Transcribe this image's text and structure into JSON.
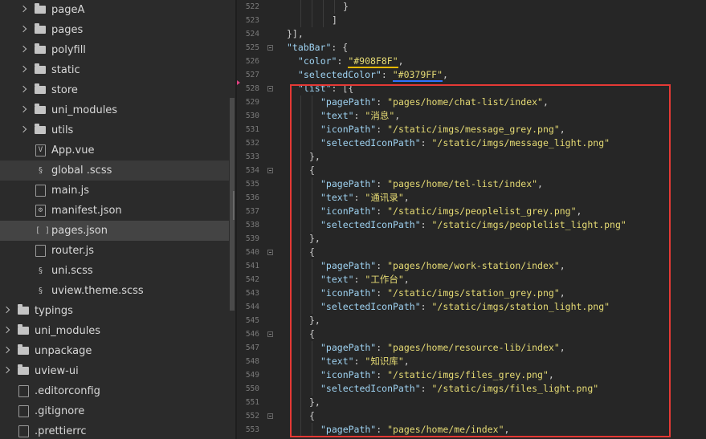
{
  "sidebar": {
    "items": [
      {
        "label": "pageA",
        "type": "folder",
        "level": 1,
        "state": ""
      },
      {
        "label": "pages",
        "type": "folder",
        "level": 1,
        "state": ""
      },
      {
        "label": "polyfill",
        "type": "folder",
        "level": 1,
        "state": ""
      },
      {
        "label": "static",
        "type": "folder",
        "level": 1,
        "state": ""
      },
      {
        "label": "store",
        "type": "folder",
        "level": 1,
        "state": ""
      },
      {
        "label": "uni_modules",
        "type": "folder",
        "level": 1,
        "state": ""
      },
      {
        "label": "utils",
        "type": "folder",
        "level": 1,
        "state": ""
      },
      {
        "label": "App.vue",
        "type": "file",
        "icon": "vue-file-icon",
        "glyph": "V",
        "level": 1,
        "state": ""
      },
      {
        "label": "global .scss",
        "type": "file",
        "icon": "scss-file-icon",
        "glyph": "§",
        "level": 1,
        "state": "sel1"
      },
      {
        "label": "main.js",
        "type": "file",
        "icon": "js-file-icon",
        "glyph": "",
        "level": 1,
        "state": ""
      },
      {
        "label": "manifest.json",
        "type": "file",
        "icon": "manifest-file-icon",
        "glyph": "⚙",
        "level": 1,
        "state": ""
      },
      {
        "label": "pages.json",
        "type": "file",
        "icon": "json-file-icon",
        "glyph": "[ ]",
        "level": 1,
        "state": "sel2"
      },
      {
        "label": "router.js",
        "type": "file",
        "icon": "js-file-icon",
        "glyph": "",
        "level": 1,
        "state": ""
      },
      {
        "label": "uni.scss",
        "type": "file",
        "icon": "scss-file-icon",
        "glyph": "§",
        "level": 1,
        "state": ""
      },
      {
        "label": "uview.theme.scss",
        "type": "file",
        "icon": "scss-file-icon",
        "glyph": "§",
        "level": 1,
        "state": ""
      },
      {
        "label": "typings",
        "type": "folder",
        "level": 0,
        "state": ""
      },
      {
        "label": "uni_modules",
        "type": "folder",
        "level": 0,
        "state": ""
      },
      {
        "label": "unpackage",
        "type": "folder",
        "level": 0,
        "state": ""
      },
      {
        "label": "uview-ui",
        "type": "folder",
        "level": 0,
        "state": ""
      },
      {
        "label": ".editorconfig",
        "type": "file",
        "icon": "config-file-icon",
        "glyph": "",
        "level": 0,
        "state": ""
      },
      {
        "label": ".gitignore",
        "type": "file",
        "icon": "config-file-icon",
        "glyph": "",
        "level": 0,
        "state": ""
      },
      {
        "label": ".prettierrc",
        "type": "file",
        "icon": "config-file-icon",
        "glyph": "",
        "level": 0,
        "state": ""
      }
    ]
  },
  "editor": {
    "lines": [
      {
        "num": "522",
        "fold": false,
        "indent": 10,
        "tokens": [
          {
            "t": "}",
            "c": "p"
          }
        ]
      },
      {
        "num": "523",
        "fold": false,
        "indent": 8,
        "tokens": [
          {
            "t": "]",
            "c": "p"
          }
        ]
      },
      {
        "num": "524",
        "fold": false,
        "indent": 0,
        "tokens": [
          {
            "t": "}],",
            "c": "p"
          }
        ]
      },
      {
        "num": "525",
        "fold": true,
        "indent": 0,
        "tokens": [
          {
            "t": "\"tabBar\"",
            "c": "k"
          },
          {
            "t": ": {",
            "c": "p"
          }
        ]
      },
      {
        "num": "526",
        "fold": false,
        "indent": 2,
        "tokens": [
          {
            "t": "\"color\"",
            "c": "k"
          },
          {
            "t": ": ",
            "c": "p"
          },
          {
            "t": "\"#908F8F\"",
            "c": "s",
            "u": "ul-y"
          },
          {
            "t": ",",
            "c": "p"
          }
        ]
      },
      {
        "num": "527",
        "fold": false,
        "indent": 2,
        "tokens": [
          {
            "t": "\"selectedColor\"",
            "c": "k"
          },
          {
            "t": ": ",
            "c": "p"
          },
          {
            "t": "\"#0379FF\"",
            "c": "s",
            "u": "ul-b"
          },
          {
            "t": ",",
            "c": "p"
          }
        ]
      },
      {
        "num": "528",
        "fold": true,
        "indent": 2,
        "tokens": [
          {
            "t": "\"list\"",
            "c": "k"
          },
          {
            "t": ": [{",
            "c": "p"
          }
        ]
      },
      {
        "num": "529",
        "fold": false,
        "indent": 6,
        "tokens": [
          {
            "t": "\"pagePath\"",
            "c": "k"
          },
          {
            "t": ": ",
            "c": "p"
          },
          {
            "t": "\"pages/home/chat-list/index\"",
            "c": "s"
          },
          {
            "t": ",",
            "c": "p"
          }
        ]
      },
      {
        "num": "530",
        "fold": false,
        "indent": 6,
        "tokens": [
          {
            "t": "\"text\"",
            "c": "k"
          },
          {
            "t": ": ",
            "c": "p"
          },
          {
            "t": "\"消息\"",
            "c": "s"
          },
          {
            "t": ",",
            "c": "p"
          }
        ]
      },
      {
        "num": "531",
        "fold": false,
        "indent": 6,
        "tokens": [
          {
            "t": "\"iconPath\"",
            "c": "k"
          },
          {
            "t": ": ",
            "c": "p"
          },
          {
            "t": "\"/static/imgs/message_grey.png\"",
            "c": "s"
          },
          {
            "t": ",",
            "c": "p"
          }
        ]
      },
      {
        "num": "532",
        "fold": false,
        "indent": 6,
        "tokens": [
          {
            "t": "\"selectedIconPath\"",
            "c": "k"
          },
          {
            "t": ": ",
            "c": "p"
          },
          {
            "t": "\"/static/imgs/message_light.png\"",
            "c": "s"
          }
        ]
      },
      {
        "num": "533",
        "fold": false,
        "indent": 4,
        "tokens": [
          {
            "t": "},",
            "c": "p"
          }
        ]
      },
      {
        "num": "534",
        "fold": true,
        "indent": 4,
        "tokens": [
          {
            "t": "{",
            "c": "p"
          }
        ]
      },
      {
        "num": "535",
        "fold": false,
        "indent": 6,
        "tokens": [
          {
            "t": "\"pagePath\"",
            "c": "k"
          },
          {
            "t": ": ",
            "c": "p"
          },
          {
            "t": "\"pages/home/tel-list/index\"",
            "c": "s"
          },
          {
            "t": ",",
            "c": "p"
          }
        ]
      },
      {
        "num": "536",
        "fold": false,
        "indent": 6,
        "tokens": [
          {
            "t": "\"text\"",
            "c": "k"
          },
          {
            "t": ": ",
            "c": "p"
          },
          {
            "t": "\"通讯录\"",
            "c": "s"
          },
          {
            "t": ",",
            "c": "p"
          }
        ]
      },
      {
        "num": "537",
        "fold": false,
        "indent": 6,
        "tokens": [
          {
            "t": "\"iconPath\"",
            "c": "k"
          },
          {
            "t": ": ",
            "c": "p"
          },
          {
            "t": "\"/static/imgs/peoplelist_grey.png\"",
            "c": "s"
          },
          {
            "t": ",",
            "c": "p"
          }
        ]
      },
      {
        "num": "538",
        "fold": false,
        "indent": 6,
        "tokens": [
          {
            "t": "\"selectedIconPath\"",
            "c": "k"
          },
          {
            "t": ": ",
            "c": "p"
          },
          {
            "t": "\"/static/imgs/peoplelist_light.png\"",
            "c": "s"
          }
        ]
      },
      {
        "num": "539",
        "fold": false,
        "indent": 4,
        "tokens": [
          {
            "t": "},",
            "c": "p"
          }
        ]
      },
      {
        "num": "540",
        "fold": true,
        "indent": 4,
        "tokens": [
          {
            "t": "{",
            "c": "p"
          }
        ]
      },
      {
        "num": "541",
        "fold": false,
        "indent": 6,
        "tokens": [
          {
            "t": "\"pagePath\"",
            "c": "k"
          },
          {
            "t": ": ",
            "c": "p"
          },
          {
            "t": "\"pages/home/work-station/index\"",
            "c": "s"
          },
          {
            "t": ",",
            "c": "p"
          }
        ]
      },
      {
        "num": "542",
        "fold": false,
        "indent": 6,
        "tokens": [
          {
            "t": "\"text\"",
            "c": "k"
          },
          {
            "t": ": ",
            "c": "p"
          },
          {
            "t": "\"工作台\"",
            "c": "s"
          },
          {
            "t": ",",
            "c": "p"
          }
        ]
      },
      {
        "num": "543",
        "fold": false,
        "indent": 6,
        "tokens": [
          {
            "t": "\"iconPath\"",
            "c": "k"
          },
          {
            "t": ": ",
            "c": "p"
          },
          {
            "t": "\"/static/imgs/station_grey.png\"",
            "c": "s"
          },
          {
            "t": ",",
            "c": "p"
          }
        ]
      },
      {
        "num": "544",
        "fold": false,
        "indent": 6,
        "tokens": [
          {
            "t": "\"selectedIconPath\"",
            "c": "k"
          },
          {
            "t": ": ",
            "c": "p"
          },
          {
            "t": "\"/static/imgs/station_light.png\"",
            "c": "s"
          }
        ]
      },
      {
        "num": "545",
        "fold": false,
        "indent": 4,
        "tokens": [
          {
            "t": "},",
            "c": "p"
          }
        ]
      },
      {
        "num": "546",
        "fold": true,
        "indent": 4,
        "tokens": [
          {
            "t": "{",
            "c": "p"
          }
        ]
      },
      {
        "num": "547",
        "fold": false,
        "indent": 6,
        "tokens": [
          {
            "t": "\"pagePath\"",
            "c": "k"
          },
          {
            "t": ": ",
            "c": "p"
          },
          {
            "t": "\"pages/home/resource-lib/index\"",
            "c": "s"
          },
          {
            "t": ",",
            "c": "p"
          }
        ]
      },
      {
        "num": "548",
        "fold": false,
        "indent": 6,
        "tokens": [
          {
            "t": "\"text\"",
            "c": "k"
          },
          {
            "t": ": ",
            "c": "p"
          },
          {
            "t": "\"知识库\"",
            "c": "s"
          },
          {
            "t": ",",
            "c": "p"
          }
        ]
      },
      {
        "num": "549",
        "fold": false,
        "indent": 6,
        "tokens": [
          {
            "t": "\"iconPath\"",
            "c": "k"
          },
          {
            "t": ": ",
            "c": "p"
          },
          {
            "t": "\"/static/imgs/files_grey.png\"",
            "c": "s"
          },
          {
            "t": ",",
            "c": "p"
          }
        ]
      },
      {
        "num": "550",
        "fold": false,
        "indent": 6,
        "tokens": [
          {
            "t": "\"selectedIconPath\"",
            "c": "k"
          },
          {
            "t": ": ",
            "c": "p"
          },
          {
            "t": "\"/static/imgs/files_light.png\"",
            "c": "s"
          }
        ]
      },
      {
        "num": "551",
        "fold": false,
        "indent": 4,
        "tokens": [
          {
            "t": "},",
            "c": "p"
          }
        ]
      },
      {
        "num": "552",
        "fold": true,
        "indent": 4,
        "tokens": [
          {
            "t": "{",
            "c": "p"
          }
        ]
      },
      {
        "num": "553",
        "fold": false,
        "indent": 6,
        "tokens": [
          {
            "t": "\"pagePath\"",
            "c": "k"
          },
          {
            "t": ": ",
            "c": "p"
          },
          {
            "t": "\"pages/home/me/index\"",
            "c": "s"
          },
          {
            "t": ",",
            "c": "p"
          }
        ]
      }
    ]
  },
  "colors": {
    "highlight_box": "#e53935",
    "string": "#e6db74",
    "key": "#9fd3f2"
  }
}
